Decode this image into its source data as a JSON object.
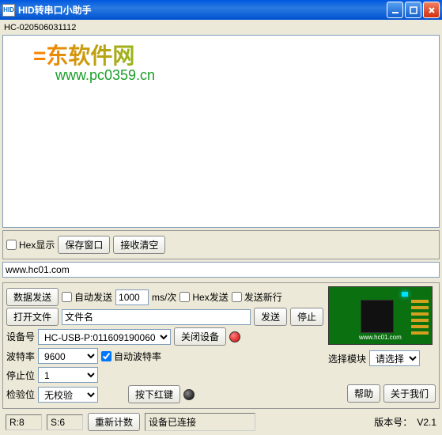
{
  "window": {
    "icon_text": "HID",
    "title": "HID转串口小助手"
  },
  "device_label": "HC-020506031112",
  "watermark": {
    "cn": "=东软件网",
    "url": "www.pc0359.cn"
  },
  "recv_toolbar": {
    "hex_display": "Hex显示",
    "save_window": "保存窗口",
    "recv_clear": "接收清空"
  },
  "send_url": "www.hc01.com",
  "send_panel": {
    "data_send": "数据发送",
    "auto_send": "自动发送",
    "interval_value": "1000",
    "interval_unit": "ms/次",
    "hex_send": "Hex发送",
    "send_newline": "发送新行",
    "open_file": "打开文件",
    "file_name": "文件名",
    "send": "发送",
    "stop": "停止",
    "device_no_label": "设备号",
    "device_no_value": "HC-USB-P:011609190060",
    "close_device": "关闭设备",
    "baud_label": "波特率",
    "baud_value": "9600",
    "auto_baud": "自动波特率",
    "stop_bit_label": "停止位",
    "stop_bit_value": "1",
    "parity_label": "检验位",
    "parity_value": "无校验",
    "press_red_key": "按下红键"
  },
  "right_panel": {
    "select_module_label": "选择模块",
    "select_module_value": "请选择",
    "help": "帮助",
    "about_us": "关于我们"
  },
  "status": {
    "r": "R:8",
    "s": "S:6",
    "reset_count": "重新计数",
    "connected": "设备已连接",
    "version_label": "版本号：",
    "version_value": "V2.1"
  }
}
